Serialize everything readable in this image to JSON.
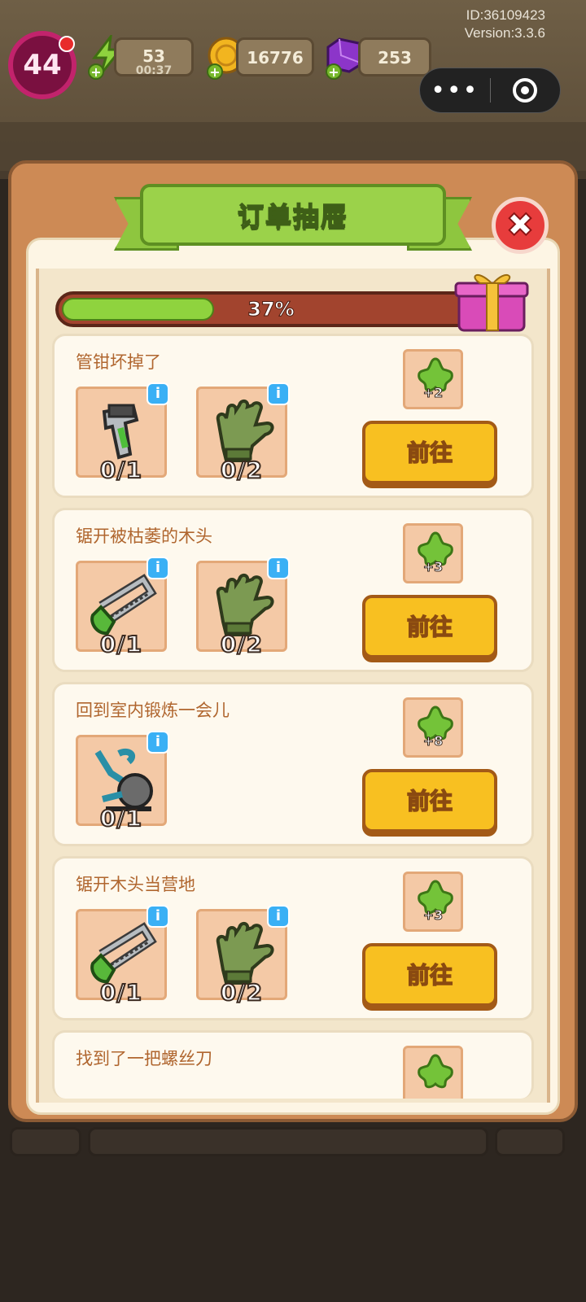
{
  "hud": {
    "level": "44",
    "energy": "53",
    "energy_timer": "00:37",
    "coins": "16776",
    "gems": "253",
    "id_text": "ID:36109423",
    "version_text": "Version:3.3.6"
  },
  "capsule": {
    "menu_icon": "•••"
  },
  "panel": {
    "title": "订单抽屉",
    "close_icon": "✖"
  },
  "progress": {
    "label": "37%",
    "value": 0.37
  },
  "go_label": "前往",
  "info_icon": "i",
  "orders": [
    {
      "title": "管钳坏掉了",
      "reward": "+2",
      "items": [
        {
          "icon": "wrench-icon",
          "count": "0/1"
        },
        {
          "icon": "glove-icon",
          "count": "0/2"
        }
      ]
    },
    {
      "title": "锯开被枯萎的木头",
      "reward": "+3",
      "items": [
        {
          "icon": "saw-icon",
          "count": "0/1"
        },
        {
          "icon": "glove-icon",
          "count": "0/2"
        }
      ]
    },
    {
      "title": "回到室内锻炼一会儿",
      "reward": "+8",
      "items": [
        {
          "icon": "exercise-bike-icon",
          "count": "0/1"
        }
      ]
    },
    {
      "title": "锯开木头当营地",
      "reward": "+3",
      "items": [
        {
          "icon": "saw-icon",
          "count": "0/1"
        },
        {
          "icon": "glove-icon",
          "count": "0/2"
        }
      ]
    },
    {
      "title": "找到了一把螺丝刀",
      "reward": "",
      "items": []
    }
  ],
  "colors": {
    "accent_green": "#8ec63f",
    "button_yellow": "#f8c021",
    "panel_brown": "#cd8a55"
  }
}
